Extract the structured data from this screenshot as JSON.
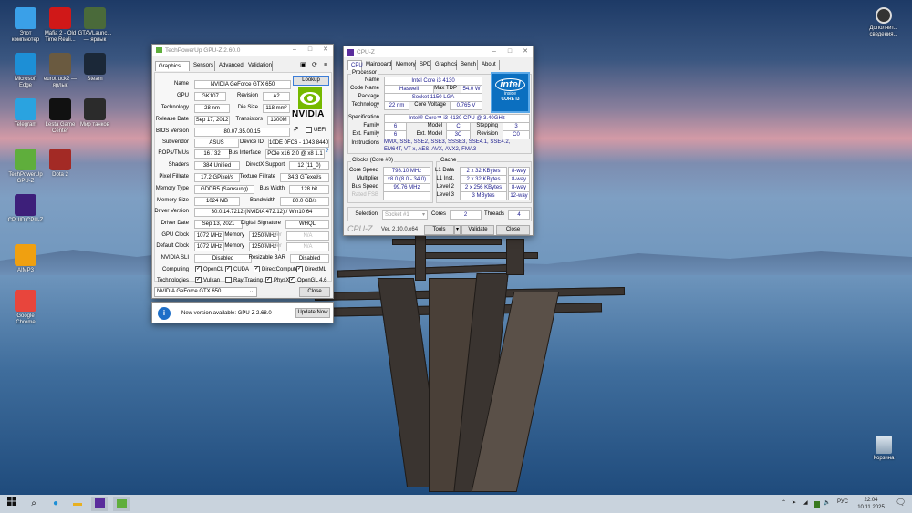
{
  "desktop": {
    "icons": [
      {
        "label": "Этот компьютер",
        "icon": "computer-icon",
        "color": "#3aa0e8"
      },
      {
        "label": "Mafia 2 - Old Time Reali...",
        "icon": "mafia-icon",
        "color": "#d01818"
      },
      {
        "label": "GTAVLaunc... — ярлык",
        "icon": "gta-icon",
        "color": "#4a6a3a"
      },
      {
        "label": "Microsoft Edge",
        "icon": "edge-icon",
        "color": "#1d8fd6"
      },
      {
        "label": "eurotruck2 — ярлык",
        "icon": "eurotruck-icon",
        "color": "#6a5a40"
      },
      {
        "label": "Steam",
        "icon": "steam-icon",
        "color": "#1b2838"
      },
      {
        "label": "Telegram",
        "icon": "telegram-icon",
        "color": "#2aa3e0"
      },
      {
        "label": "Lesta Game Center",
        "icon": "lesta-icon",
        "color": "#111111"
      },
      {
        "label": "Мир танков",
        "icon": "tanks-icon",
        "color": "#2b2b2b"
      },
      {
        "label": "TechPowerUp GPU-Z",
        "icon": "gpuz-icon",
        "color": "#5fae3c"
      },
      {
        "label": "Dota 2",
        "icon": "dota-icon",
        "color": "#a32a25"
      },
      {
        "label": "CPUID CPU-Z",
        "icon": "cpuz-icon",
        "color": "#3d1f7a"
      },
      {
        "label": "AIMP3",
        "icon": "aimp-icon",
        "color": "#f0a010"
      },
      {
        "label": "Google Chrome",
        "icon": "chrome-icon",
        "color": "#e8453c"
      }
    ],
    "right_icon": "Дополнит... сведения...",
    "recycle": "Корзина"
  },
  "gpuz": {
    "title": "TechPowerUp GPU-Z 2.60.0",
    "tabs": [
      "Graphics Card",
      "Sensors",
      "Advanced",
      "Validation"
    ],
    "labels": {
      "name": "Name",
      "gpu": "GPU",
      "revision": "Revision",
      "technology": "Technology",
      "die_size": "Die Size",
      "release_date": "Release Date",
      "transistors": "Transistors",
      "bios": "BIOS Version",
      "uefi": "UEFI",
      "subvendor": "Subvendor",
      "device_id": "Device ID",
      "rops": "ROPs/TMUs",
      "bus_interface": "Bus Interface",
      "shaders": "Shaders",
      "directx": "DirectX Support",
      "pixel": "Pixel Fillrate",
      "texture": "Texture Fillrate",
      "mem_type": "Memory Type",
      "bus_width": "Bus Width",
      "mem_size": "Memory Size",
      "bandwidth": "Bandwidth",
      "driver_version": "Driver Version",
      "driver_date": "Driver Date",
      "digital_sig": "Digital Signature",
      "gpu_clock": "GPU Clock",
      "memory": "Memory",
      "shader": "Shader",
      "default_clock": "Default Clock",
      "sli": "NVIDIA SLI",
      "resizable_bar": "Resizable BAR",
      "computing": "Computing",
      "technologies": "Technologies"
    },
    "values": {
      "name": "NVIDIA GeForce GTX 650",
      "gpu": "GK107",
      "revision": "A2",
      "technology": "28 nm",
      "die_size": "118 mm²",
      "release_date": "Sep 17, 2012",
      "transistors": "1300M",
      "bios": "80.07.35.00.15",
      "subvendor": "ASUS",
      "device_id": "10DE 0FC6 - 1043 8440",
      "rops": "16 / 32",
      "bus_interface": "PCIe x16 2.0 @ x8 1.1",
      "shaders": "384 Unified",
      "directx": "12 (11_0)",
      "pixel": "17.2 GPixel/s",
      "texture": "34.3 GTexel/s",
      "mem_type": "GDDR5 (Samsung)",
      "bus_width": "128 bit",
      "mem_size": "1024 MB",
      "bandwidth": "80.0 GB/s",
      "driver_version": "30.0.14.7212 (NVIDIA 472.12) / Win10 64",
      "driver_date": "Sep 13, 2021",
      "digital_sig": "WHQL",
      "gpu_clock": "1072 MHz",
      "gpu_mem": "1250 MHz",
      "gpu_shader": "N/A",
      "default_clock": "1072 MHz",
      "default_mem": "1250 MHz",
      "default_shader": "N/A",
      "sli": "Disabled",
      "resizable_bar": "Disabled"
    },
    "computing": [
      "OpenCL",
      "CUDA",
      "DirectCompute",
      "DirectML"
    ],
    "technologies": [
      {
        "label": "Vulkan",
        "checked": true
      },
      {
        "label": "Ray Tracing",
        "checked": false
      },
      {
        "label": "PhysX",
        "checked": true
      },
      {
        "label": "OpenGL 4.6",
        "checked": true
      }
    ],
    "uefi_checked": false,
    "lookup": "Lookup",
    "logo": "NVIDIA",
    "help": "?",
    "selected_card": "NVIDIA GeForce GTX 650",
    "close": "Close",
    "notice": "New version available: GPU-Z 2.68.0",
    "update": "Update Now"
  },
  "cpuz": {
    "title": "CPU-Z",
    "tabs": [
      "CPU",
      "Mainboard",
      "Memory",
      "SPD",
      "Graphics",
      "Bench",
      "About"
    ],
    "processor": "Processor",
    "labels": {
      "name": "Name",
      "code_name": "Code Name",
      "max_tdp": "Max TDP",
      "package": "Package",
      "technology": "Technology",
      "core_voltage": "Core Voltage",
      "specification": "Specification",
      "family": "Family",
      "model": "Model",
      "stepping": "Stepping",
      "ext_family": "Ext. Family",
      "ext_model": "Ext. Model",
      "revision": "Revision",
      "instructions": "Instructions",
      "clocks": "Clocks (Core #0)",
      "core_speed": "Core Speed",
      "multiplier": "Multiplier",
      "bus_speed": "Bus Speed",
      "rated_fsb": "Rated FSB",
      "cache": "Cache",
      "l1d": "L1 Data",
      "l1i": "L1 Inst.",
      "l2": "Level 2",
      "l3": "Level 3",
      "selection": "Selection",
      "cores": "Cores",
      "threads": "Threads"
    },
    "values": {
      "name": "Intel Core i3 4130",
      "code_name": "Haswell",
      "max_tdp": "54.0 W",
      "package": "Socket 1150 LGA",
      "technology": "22 nm",
      "core_voltage": "0.765 V",
      "specification": "Intel® Core™ i3-4130 CPU @ 3.40GHz",
      "family": "6",
      "model": "C",
      "stepping": "3",
      "ext_family": "6",
      "ext_model": "3C",
      "revision": "C0",
      "instructions": "MMX, SSE, SSE2, SSE3, SSSE3, SSE4.1, SSE4.2, EM64T, VT-x, AES, AVX, AVX2, FMA3",
      "core_speed": "798.10 MHz",
      "multiplier": "x8.0 (8.0 - 34.0)",
      "bus_speed": "99.76 MHz",
      "rated_fsb": "",
      "l1d": "2 x 32 KBytes",
      "l1d_way": "8-way",
      "l1i": "2 x 32 KBytes",
      "l1i_way": "8-way",
      "l2": "2 x 256 KBytes",
      "l2_way": "8-way",
      "l3": "3 MBytes",
      "l3_way": "12-way",
      "selection": "Socket #1",
      "cores": "2",
      "threads": "4"
    },
    "logo": {
      "brand": "intel",
      "inside": "inside",
      "model": "CORE i3"
    },
    "footer_logo": "CPU-Z",
    "version": "Ver. 2.10.0.x64",
    "tools": "Tools",
    "validate": "Validate",
    "close": "Close"
  },
  "taskbar": {
    "lang": "РУС",
    "time": "22:04",
    "date": "10.11.2025"
  }
}
